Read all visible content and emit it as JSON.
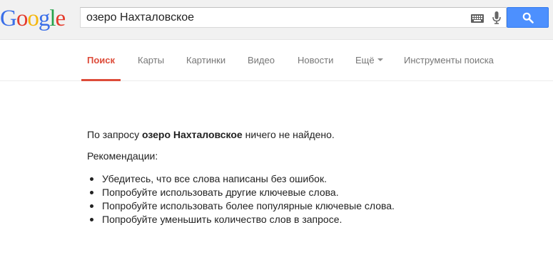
{
  "logo": {
    "letters": [
      "G",
      "o",
      "o",
      "g",
      "l",
      "e"
    ],
    "colors": [
      "#3a6ee8",
      "#e53b2c",
      "#f5b70d",
      "#3a6ee8",
      "#26a24a",
      "#e53b2c"
    ]
  },
  "search": {
    "query": "озеро Нахталовское",
    "keyboard_icon": "keyboard-icon",
    "mic_icon": "microphone-icon",
    "button_icon": "search-icon",
    "button_color": "#4d90fe"
  },
  "tabs": [
    {
      "label": "Поиск",
      "active": true
    },
    {
      "label": "Карты"
    },
    {
      "label": "Картинки"
    },
    {
      "label": "Видео"
    },
    {
      "label": "Новости"
    },
    {
      "label": "Ещё"
    },
    {
      "label": "Инструменты поиска"
    }
  ],
  "accent_color": "#dd4b39",
  "message": {
    "prefix": "По запросу ",
    "query": "озеро Нахталовское",
    "suffix": " ничего не найдено.",
    "recs_heading": "Рекомендации:",
    "recommendations": [
      "Убедитесь, что все слова написаны без ошибок.",
      "Попробуйте использовать другие ключевые слова.",
      "Попробуйте использовать более популярные ключевые слова.",
      "Попробуйте уменьшить количество слов в запросе."
    ]
  }
}
